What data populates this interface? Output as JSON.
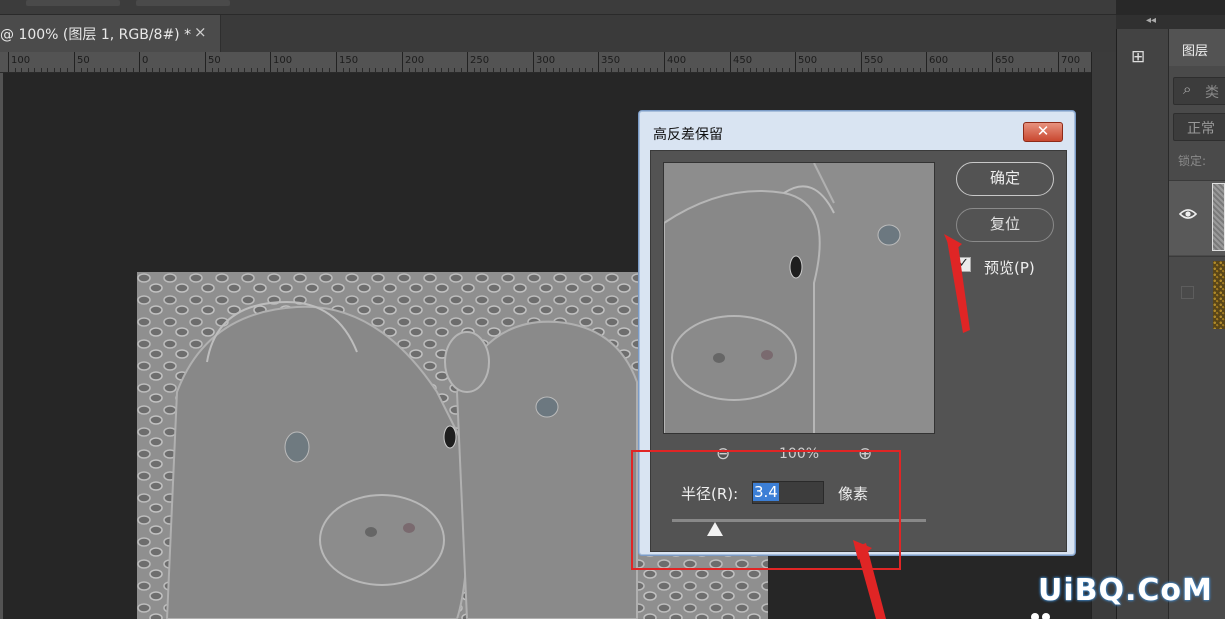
{
  "document": {
    "tab_label": "@ 100% (图层 1, RGB/8#) *",
    "close_glyph": "×"
  },
  "ruler": {
    "labels": [
      "100",
      "50",
      "0",
      "50",
      "100",
      "150",
      "200",
      "250",
      "300",
      "350",
      "400",
      "450",
      "500",
      "550",
      "600",
      "650",
      "700"
    ]
  },
  "panels": {
    "collapse_glyph": "◂◂",
    "history_glyph": "⊞",
    "layers_tab": "图层",
    "filter_placeholder": "类",
    "filter_icon": "⌕",
    "blend_mode": "正常",
    "lock_label": "锁定:",
    "eye_glyph": "👁"
  },
  "dialog": {
    "title": "高反差保留",
    "close_glyph": "✕",
    "ok_label": "确定",
    "reset_label": "复位",
    "preview_checked": true,
    "preview_label": "预览(P)",
    "check_glyph": "✓",
    "zoom_out_glyph": "⊖",
    "zoom_in_glyph": "⊕",
    "zoom_level": "100%",
    "radius_label": "半径(R):",
    "radius_value": "3.4",
    "unit_label": "像素",
    "slider_fraction": 0.17
  },
  "watermark": "UiBQ.CoM",
  "colors": {
    "annotation_red": "#e02525",
    "dialog_frame": "#d9e4f2",
    "selection_blue": "#3c7fd6"
  }
}
